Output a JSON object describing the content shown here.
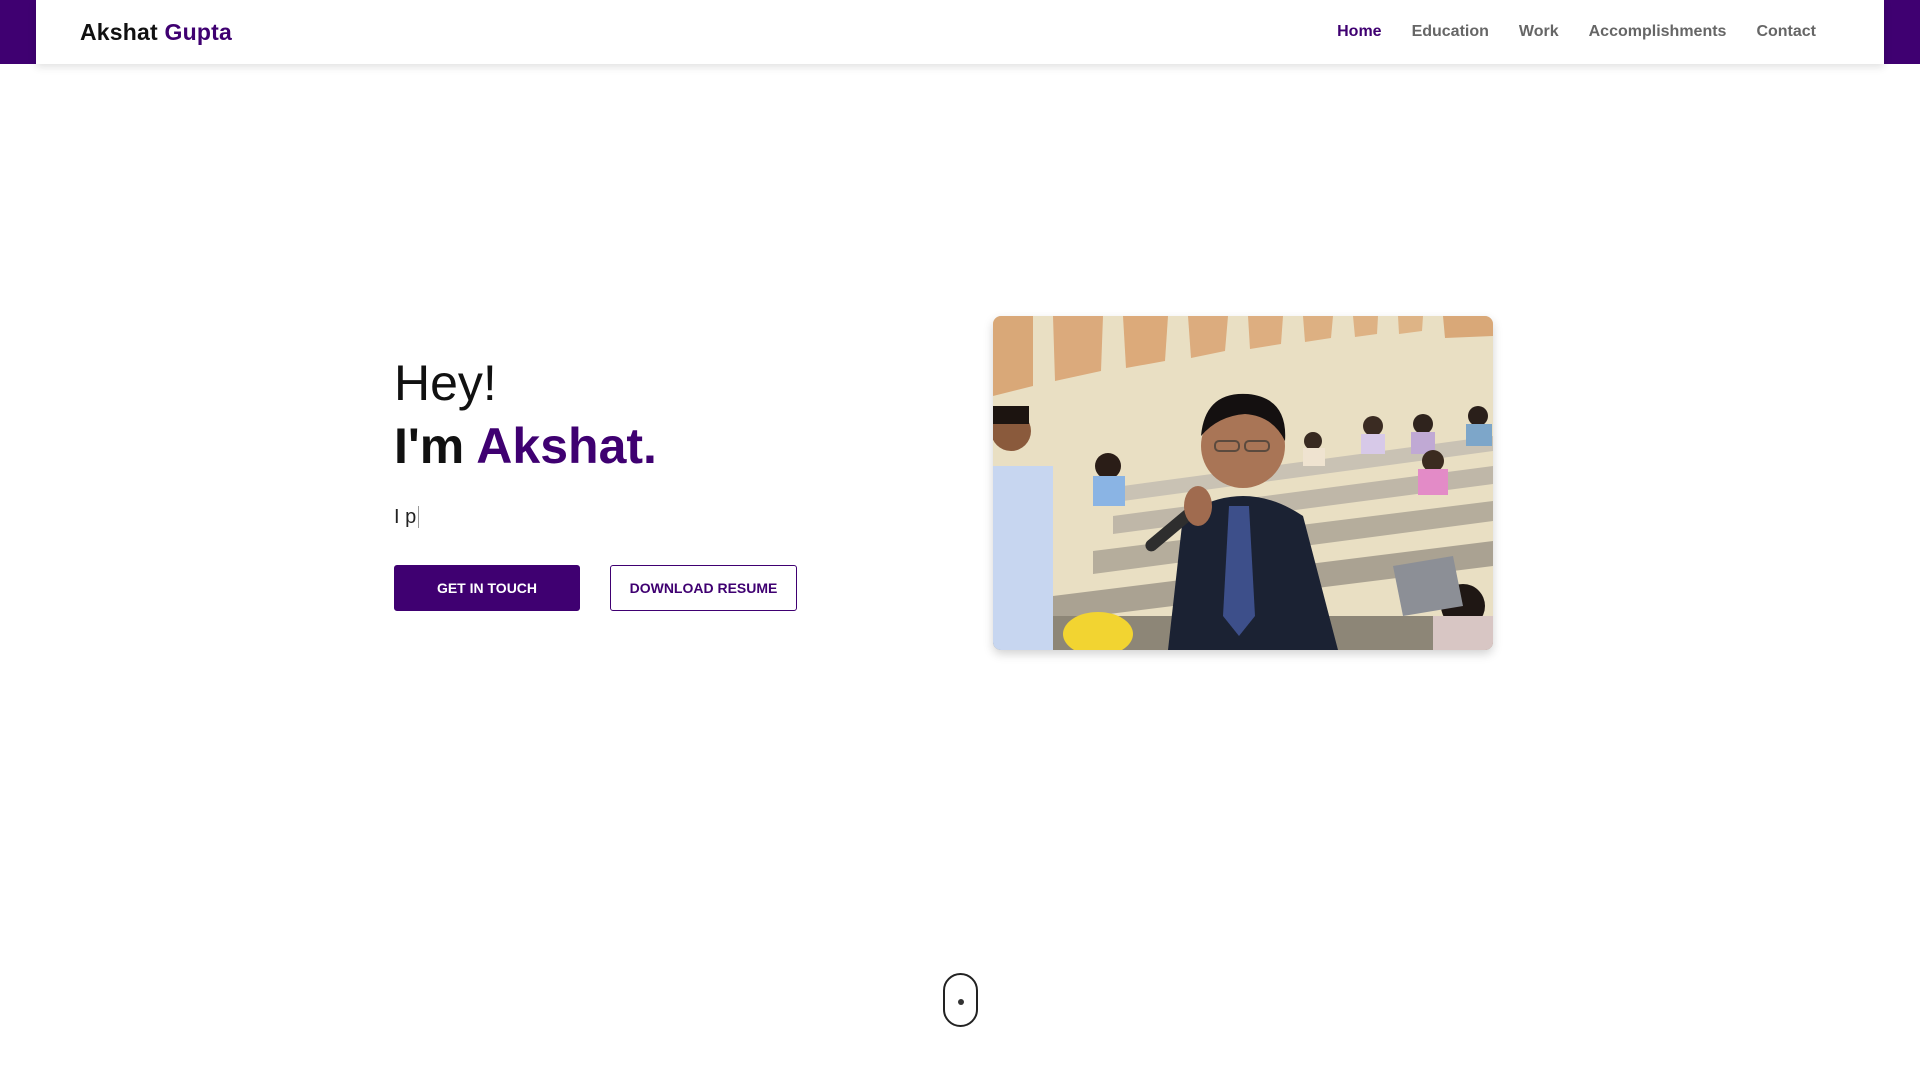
{
  "brand": {
    "first_name": "Akshat",
    "last_name": "Gupta"
  },
  "nav": {
    "items": [
      {
        "label": "Home",
        "active": true
      },
      {
        "label": "Education",
        "active": false
      },
      {
        "label": "Work",
        "active": false
      },
      {
        "label": "Accomplishments",
        "active": false
      },
      {
        "label": "Contact",
        "active": false
      }
    ]
  },
  "hero": {
    "greeting": "Hey!",
    "intro_prefix": "I'm",
    "intro_name": "Akshat.",
    "typed_text": "I p",
    "primary_button": "GET IN TOUCH",
    "secondary_button": "DOWNLOAD RESUME"
  },
  "colors": {
    "accent": "#3f0071",
    "nav_inactive": "#666666",
    "text": "#111111"
  },
  "icons": {
    "scroll": "mouse-scroll-icon"
  }
}
